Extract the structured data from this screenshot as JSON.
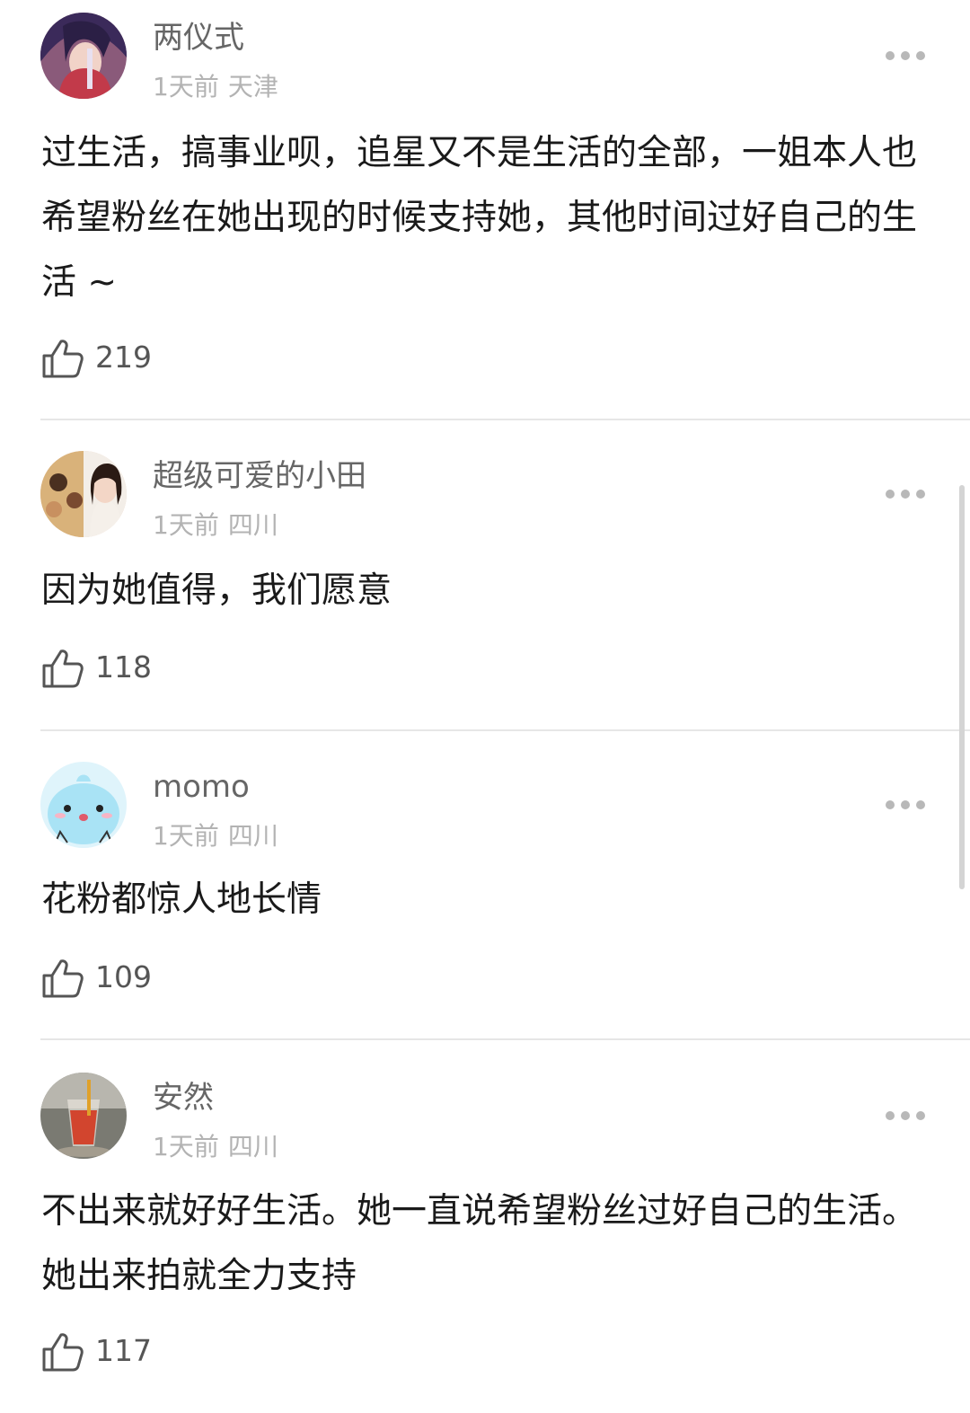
{
  "comments": [
    {
      "username": "两仪式",
      "time": "1天前",
      "location": "天津",
      "text": "过生活，搞事业呗，追星又不是生活的全部，一姐本人也希望粉丝在她出现的时候支持她，其他时间过好自己的生活 ~",
      "likes": "219",
      "avatar_icon": "anime-girl-avatar"
    },
    {
      "username": "超级可爱的小田",
      "time": "1天前",
      "location": "四川",
      "text": "因为她值得，我们愿意",
      "likes": "118",
      "avatar_icon": "photo-collage-avatar"
    },
    {
      "username": "momo",
      "time": "1天前",
      "location": "四川",
      "text": "花粉都惊人地长情",
      "likes": "109",
      "avatar_icon": "blue-cartoon-avatar"
    },
    {
      "username": "安然",
      "time": "1天前",
      "location": "四川",
      "text": "不出来就好好生活。她一直说希望粉丝过好自己的生活。她出来拍就全力支持",
      "likes": "117",
      "avatar_icon": "drink-photo-avatar"
    }
  ],
  "icons": {
    "like": "thumbs-up-icon",
    "more": "more-dots-icon"
  },
  "colors": {
    "username": "#666666",
    "meta": "#b3b3b3",
    "text": "#1a1a1a",
    "divider": "#e6e6e6"
  }
}
